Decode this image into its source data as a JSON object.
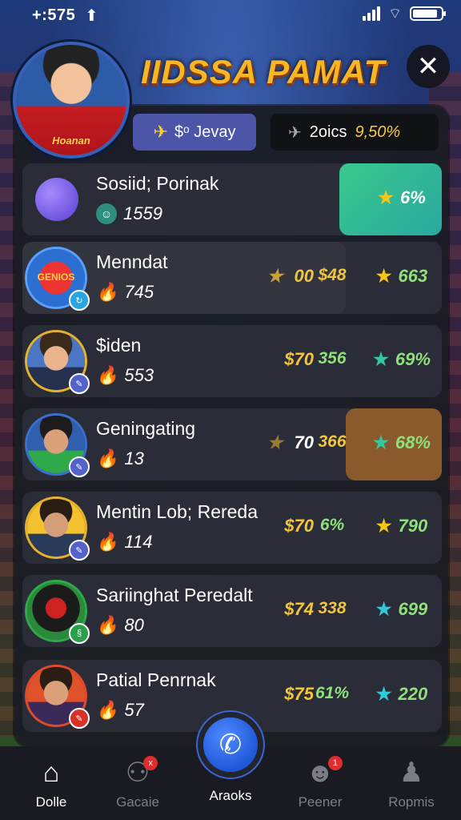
{
  "status": {
    "time": "+:575",
    "arrow": "⬆"
  },
  "title": "IIDSSA PAMAT",
  "jersey_text": "Hoanan",
  "close_label": "✕",
  "chips": {
    "a_label": "$ᵒ Jevay",
    "b_label": "2oics",
    "b_value": "9,50%"
  },
  "rows": [
    {
      "name": "Sosiid; Porinak",
      "score": "1559",
      "col1": "",
      "col2": "",
      "col3": "6%",
      "star_color": "#f5c518"
    },
    {
      "name": "Menndat",
      "score": "745",
      "col1": "00",
      "col2": "$48",
      "col3": "663",
      "col1_star": true,
      "star_color": "#f5c518"
    },
    {
      "name": "$iden",
      "score": "553",
      "col1": "$70",
      "col2": "356",
      "col3": "69%",
      "star_color": "#35c8a0"
    },
    {
      "name": "Geningating",
      "score": "13",
      "col1": "70",
      "col2": "366",
      "col3": "68%",
      "col1_star": true,
      "star_color": "#35c8a0"
    },
    {
      "name": "Mentin Lob; Rereda",
      "score": "114",
      "col1": "$70",
      "col2": "6%",
      "col3": "790",
      "star_color": "#f5c518"
    },
    {
      "name": "Sariinghat Peredalt",
      "score": "80",
      "col1": "$74",
      "col2": "338",
      "col3": "699",
      "star_color": "#35c8d8"
    },
    {
      "name": "Patial Penrnak",
      "score": "57",
      "col1": "$75",
      "col2": "61%",
      "col3": "220",
      "star_color": "#35c8d8"
    }
  ],
  "row1_badge": "GENIOS",
  "nav": [
    {
      "label": "Dolle",
      "icon": "home-icon",
      "badge": ""
    },
    {
      "label": "Gacaie",
      "icon": "search-person-icon",
      "badge": "x"
    },
    {
      "label": "Araoks",
      "icon": "phone-icon",
      "badge": ""
    },
    {
      "label": "Peener",
      "icon": "face-icon",
      "badge": "1"
    },
    {
      "label": "Ropmis",
      "icon": "person-icon",
      "badge": ""
    }
  ],
  "colors": {
    "accent": "#f7b623",
    "green": "#3ac28e",
    "highlight_orange": "#8a5a2c"
  }
}
